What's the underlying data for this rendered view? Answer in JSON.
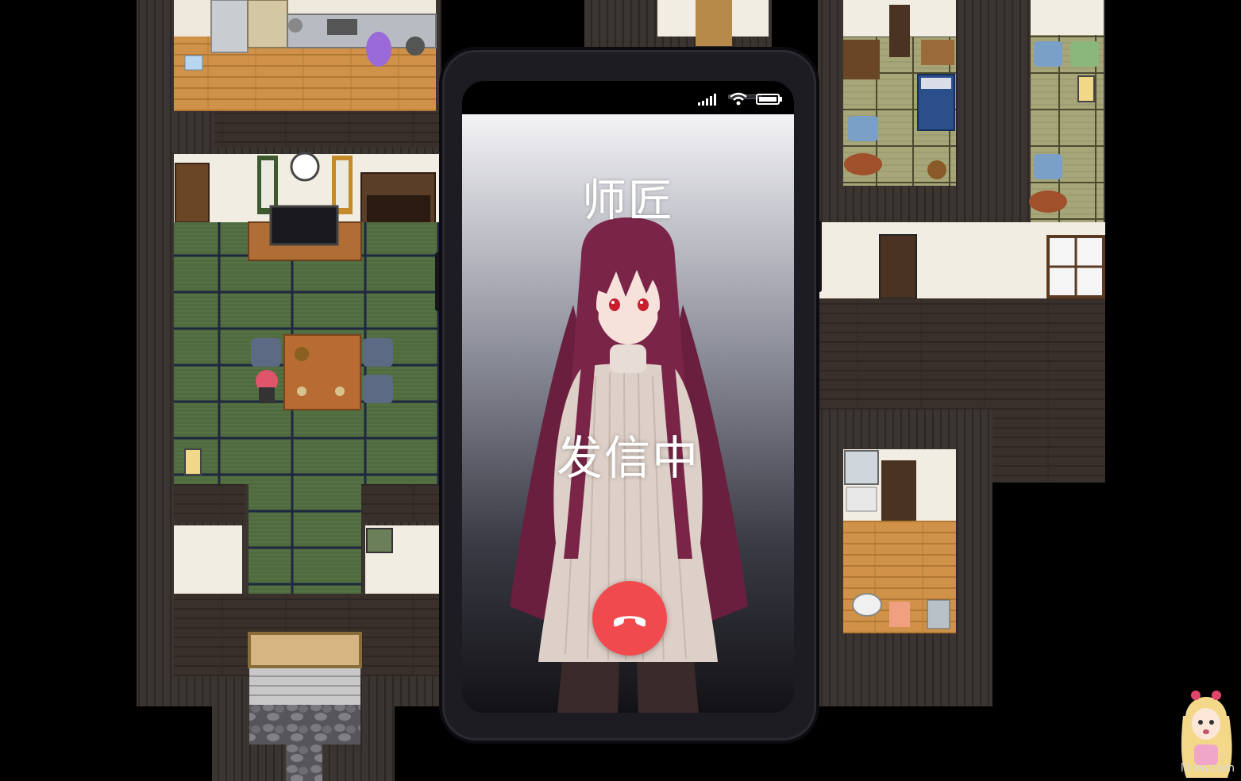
{
  "game": {
    "scene": "house-map"
  },
  "phone": {
    "caller_name": "师匠",
    "call_status": "发信中",
    "hangup_icon": "phone-hangup-icon",
    "status_icons": [
      "signal-icon",
      "wifi-icon",
      "battery-icon"
    ]
  },
  "colors": {
    "hangup": "#f04a4e",
    "tatami": "#4a6a3c",
    "wood_floor": "#c88a40",
    "wall_dark": "#2a2420"
  },
  "watermark": {
    "text": "lilixw.com"
  }
}
